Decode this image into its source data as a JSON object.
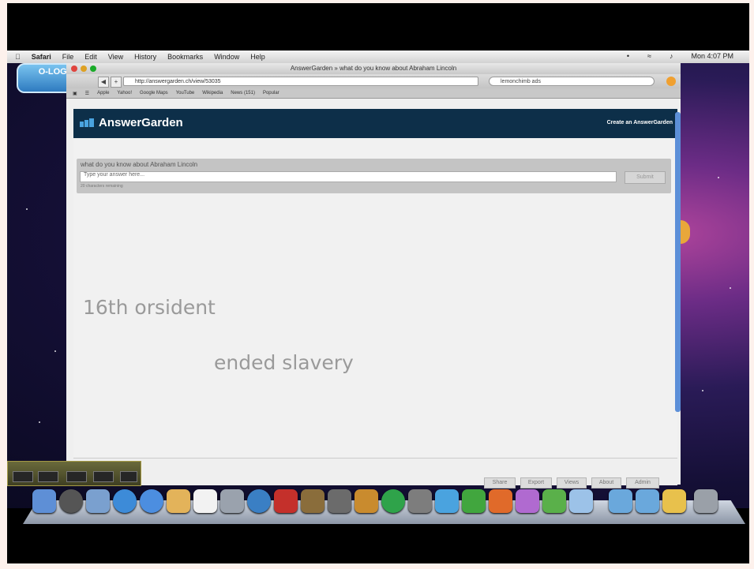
{
  "menubar": {
    "apple": "",
    "items": [
      "Safari",
      "File",
      "Edit",
      "View",
      "History",
      "Bookmarks",
      "Window",
      "Help"
    ],
    "clock": "Mon 4:07 PM"
  },
  "watermark": {
    "title": "O-LOGO",
    "subtitle": ""
  },
  "browser": {
    "window_title": "AnswerGarden » what do you know about Abraham Lincoln",
    "url": "http://answergarden.ch/view/53035",
    "search_placeholder": "lemonchimb ads",
    "bookmarks": [
      "Apple",
      "Yahoo!",
      "Google Maps",
      "YouTube",
      "Wikipedia",
      "News (151)",
      "Popular"
    ]
  },
  "app": {
    "logo_text": "AnswerGarden",
    "create_link": "Create an AnswerGarden",
    "question": "what do you know about Abraham Lincoln",
    "answer_placeholder": "Type your answer here...",
    "submit_label": "Submit",
    "char_counter": "20 characters remaining",
    "words": [
      "16th orsident",
      "ended slavery"
    ],
    "footer_buttons": [
      "Share",
      "Export",
      "Views",
      "About",
      "Admin"
    ]
  },
  "colors": {
    "header": "#0d2f49",
    "word": "#9a9a9a"
  }
}
